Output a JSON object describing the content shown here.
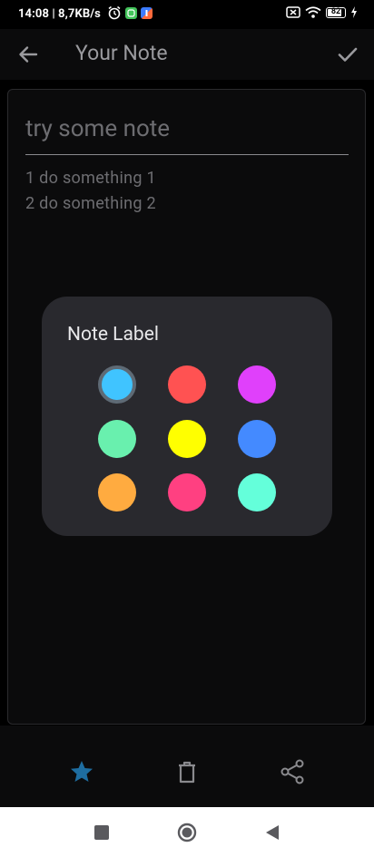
{
  "status_bar": {
    "time_speed": "14:08 | 8,7KB/s",
    "battery": "82",
    "icons": [
      "alarm-icon",
      "app-notification-icon",
      "app-notification-icon",
      "sim-off-icon",
      "wifi-icon",
      "battery-icon",
      "charging-icon"
    ]
  },
  "app_bar": {
    "title": "Your Note",
    "back_icon": "arrow-left-icon",
    "confirm_icon": "check-icon"
  },
  "note": {
    "title_placeholder": "try some note",
    "body_lines": [
      "1 do something 1",
      "2 do something 2"
    ]
  },
  "label_dialog": {
    "title": "Note Label",
    "colors": [
      "#40c4ff",
      "#ff5252",
      "#e040fb",
      "#69f0ae",
      "#ffff00",
      "#448aff",
      "#ffab40",
      "#ff4081",
      "#64ffda"
    ],
    "selected_index": 0
  },
  "actions": {
    "favorite": "star-icon",
    "delete": "trash-icon",
    "share": "share-icon",
    "favorite_color": "#1e6da0",
    "icon_color": "#8a8a8e"
  },
  "system_nav": [
    "recents-square-icon",
    "home-circle-icon",
    "back-triangle-icon"
  ]
}
